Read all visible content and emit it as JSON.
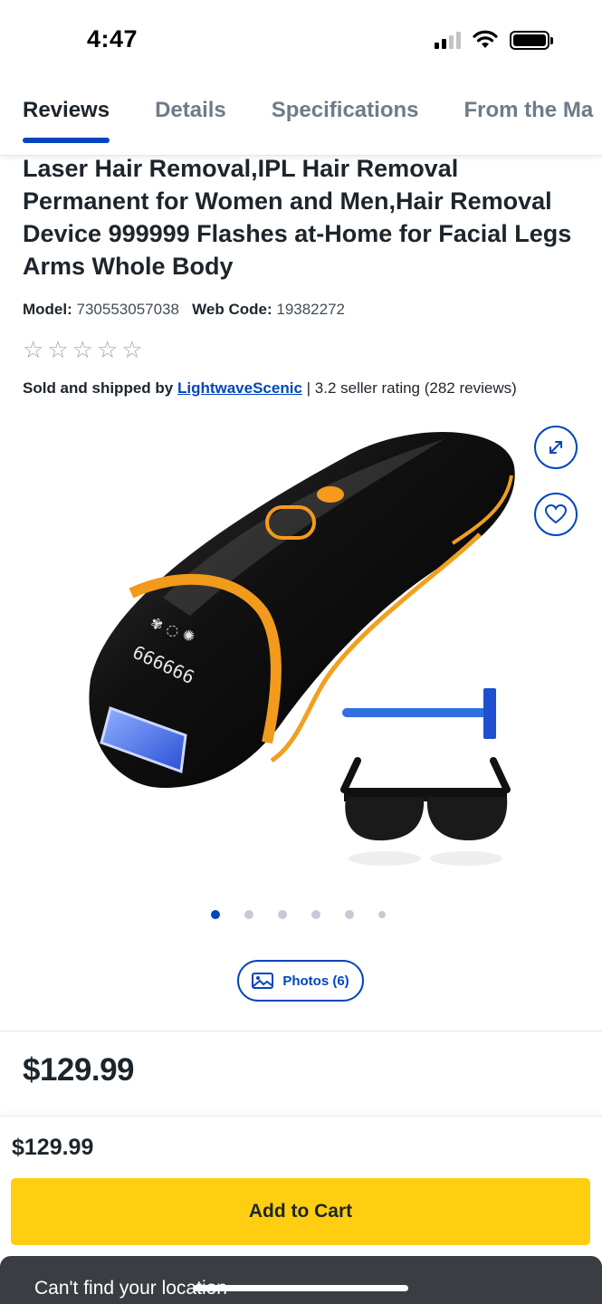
{
  "status_bar": {
    "time": "4:47"
  },
  "tabs": [
    {
      "label": "Reviews"
    },
    {
      "label": "Details"
    },
    {
      "label": "Specifications"
    },
    {
      "label": "From the Ma"
    }
  ],
  "product": {
    "title": "Laser Hair Removal,IPL Hair Removal Permanent for Women and Men,Hair Removal Device 999999 Flashes at-Home for Facial Legs Arms Whole Body",
    "model_label": "Model:",
    "model_value": "730553057038",
    "webcode_label": "Web Code:",
    "webcode_value": "19382272",
    "rating_stars": 0,
    "sold_by_lead": "Sold and shipped by",
    "seller_name": "LightwaveScenic",
    "seller_rating": "| 3.2 seller rating (282 reviews)",
    "device_display": "666666",
    "price": "$129.99"
  },
  "gallery": {
    "image_count": 6,
    "active_index": 0,
    "photos_label": "Photos (6)"
  },
  "sticky_footer": {
    "price": "$129.99",
    "add_to_cart_label": "Add to Cart",
    "toast_text": "Can't find your location"
  },
  "colors": {
    "accent_blue": "#0046be",
    "cart_yellow": "#ffce11",
    "text_dark": "#1d252c",
    "toast_bg": "#3a3d41"
  }
}
